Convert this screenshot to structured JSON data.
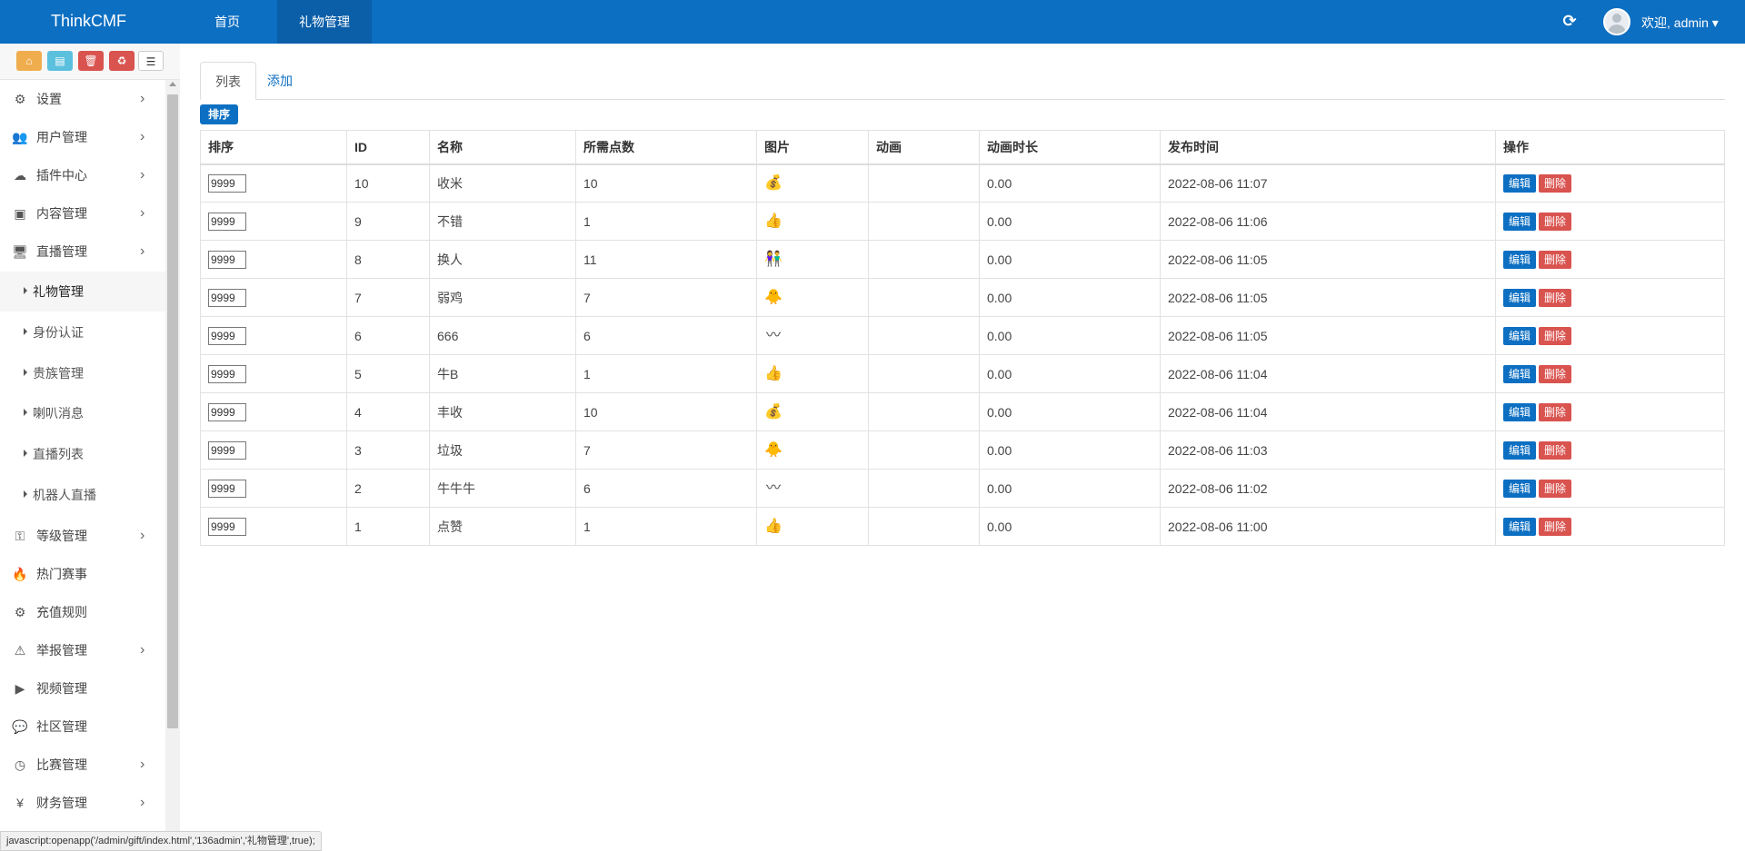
{
  "navbar": {
    "brand": "ThinkCMF",
    "tabs": [
      {
        "label": "首页"
      },
      {
        "label": "礼物管理"
      }
    ],
    "refresh_icon": "refresh-icon",
    "user_label": "欢迎, admin ▾"
  },
  "shortcuts": [
    {
      "icon": "home-icon",
      "glyph": "⌂",
      "color": "#f0ad4e"
    },
    {
      "icon": "file-icon",
      "glyph": "▤",
      "color": "#5bc0de"
    },
    {
      "icon": "trash-icon",
      "glyph": "🗑",
      "color": "#d9534f"
    },
    {
      "icon": "recycle-icon",
      "glyph": "♻",
      "color": "#d9534f"
    },
    {
      "icon": "list-icon",
      "glyph": "☰",
      "color": "#ffffff"
    }
  ],
  "sidebar": {
    "items": [
      {
        "label": "设置",
        "icon": "gears-icon",
        "glyph": "⚙",
        "arrow": true
      },
      {
        "label": "用户管理",
        "icon": "users-icon",
        "glyph": "👥",
        "arrow": true
      },
      {
        "label": "插件中心",
        "icon": "cloud-icon",
        "glyph": "☁",
        "arrow": true
      },
      {
        "label": "内容管理",
        "icon": "archive-icon",
        "glyph": "▣",
        "arrow": true
      },
      {
        "label": "直播管理",
        "icon": "desktop-icon",
        "glyph": "🖥",
        "arrow": true
      }
    ],
    "subitems": [
      {
        "label": "礼物管理",
        "active": true
      },
      {
        "label": "身份认证"
      },
      {
        "label": "贵族管理"
      },
      {
        "label": "喇叭消息"
      },
      {
        "label": "直播列表"
      },
      {
        "label": "机器人直播"
      }
    ],
    "items_after": [
      {
        "label": "等级管理",
        "icon": "sitemap-icon",
        "glyph": "⚿",
        "arrow": true
      },
      {
        "label": "热门赛事",
        "icon": "fire-icon",
        "glyph": "🔥",
        "arrow": false
      },
      {
        "label": "充值规则",
        "icon": "gears-icon",
        "glyph": "⚙",
        "arrow": false
      },
      {
        "label": "举报管理",
        "icon": "warning-icon",
        "glyph": "⚠",
        "arrow": true
      },
      {
        "label": "视频管理",
        "icon": "video-file-icon",
        "glyph": "▶",
        "arrow": false
      },
      {
        "label": "社区管理",
        "icon": "comment-icon",
        "glyph": "💬",
        "arrow": false
      },
      {
        "label": "比赛管理",
        "icon": "dashboard-icon",
        "glyph": "◷",
        "arrow": true
      },
      {
        "label": "财务管理",
        "icon": "yen-icon",
        "glyph": "¥",
        "arrow": true
      }
    ]
  },
  "content": {
    "tabs": [
      {
        "label": "列表",
        "active": true
      },
      {
        "label": "添加",
        "active": false
      }
    ],
    "sort_button": "排序",
    "table": {
      "headers": [
        "排序",
        "ID",
        "名称",
        "所需点数",
        "图片",
        "动画",
        "动画时长",
        "发布时间",
        "操作"
      ],
      "rows": [
        {
          "sort": "9999",
          "id": "10",
          "name": "收米",
          "points": "10",
          "image_icon": "treasure-icon",
          "glyph": "💰",
          "anim": "",
          "duration": "0.00",
          "time": "2022-08-06 11:07"
        },
        {
          "sort": "9999",
          "id": "9",
          "name": "不错",
          "points": "1",
          "image_icon": "thumbs-up-icon",
          "glyph": "👍",
          "anim": "",
          "duration": "0.00",
          "time": "2022-08-06 11:06"
        },
        {
          "sort": "9999",
          "id": "8",
          "name": "换人",
          "points": "11",
          "image_icon": "people-icon",
          "glyph": "👫",
          "anim": "",
          "duration": "0.00",
          "time": "2022-08-06 11:05"
        },
        {
          "sort": "9999",
          "id": "7",
          "name": "弱鸡",
          "points": "7",
          "image_icon": "chick-icon",
          "glyph": "🐥",
          "anim": "",
          "duration": "0.00",
          "time": "2022-08-06 11:05"
        },
        {
          "sort": "9999",
          "id": "6",
          "name": "666",
          "points": "6",
          "image_icon": "text-666-icon",
          "glyph": "〰",
          "anim": "",
          "duration": "0.00",
          "time": "2022-08-06 11:05"
        },
        {
          "sort": "9999",
          "id": "5",
          "name": "牛B",
          "points": "1",
          "image_icon": "thumbs-up-icon",
          "glyph": "👍",
          "anim": "",
          "duration": "0.00",
          "time": "2022-08-06 11:04"
        },
        {
          "sort": "9999",
          "id": "4",
          "name": "丰收",
          "points": "10",
          "image_icon": "treasure-icon",
          "glyph": "💰",
          "anim": "",
          "duration": "0.00",
          "time": "2022-08-06 11:04"
        },
        {
          "sort": "9999",
          "id": "3",
          "name": "垃圾",
          "points": "7",
          "image_icon": "chick-icon",
          "glyph": "🐥",
          "anim": "",
          "duration": "0.00",
          "time": "2022-08-06 11:03"
        },
        {
          "sort": "9999",
          "id": "2",
          "name": "牛牛牛",
          "points": "6",
          "image_icon": "text-666-icon",
          "glyph": "〰",
          "anim": "",
          "duration": "0.00",
          "time": "2022-08-06 11:02"
        },
        {
          "sort": "9999",
          "id": "1",
          "name": "点赞",
          "points": "1",
          "image_icon": "thumbs-up-icon",
          "glyph": "👍",
          "anim": "",
          "duration": "0.00",
          "time": "2022-08-06 11:00"
        }
      ],
      "edit_label": "编辑",
      "delete_label": "删除"
    }
  },
  "statusbar": "javascript:openapp('/admin/gift/index.html','136admin','礼物管理',true);"
}
